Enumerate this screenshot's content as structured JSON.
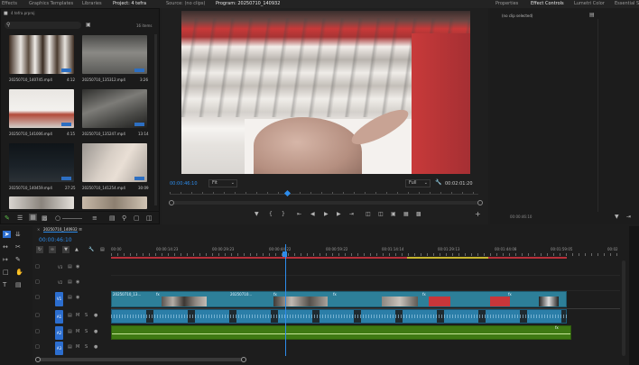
{
  "top_tabs": {
    "effects": "Effects",
    "graphics_templates": "Graphics Templates",
    "libraries": "Libraries",
    "project": "Project: 4 tefra",
    "source": "Source: (no clips)",
    "program": "Program: 20250710_140932",
    "properties": "Properties",
    "effect_controls": "Effect Controls",
    "lumetri": "Lumetri Color",
    "essential": "Essential Sou"
  },
  "project": {
    "file": "4 tefra.prproj",
    "item_count": "16 items",
    "search_placeholder": "",
    "items": [
      {
        "name": "20250710_140745.mp4",
        "duration": "4:12"
      },
      {
        "name": "20250710_135312.mp4",
        "duration": "3:26"
      },
      {
        "name": "20250710_141006.mp4",
        "duration": "4:15"
      },
      {
        "name": "20250710_135247.mp4",
        "duration": "13:14"
      },
      {
        "name": "20250710_140459.mp4",
        "duration": "27:25"
      },
      {
        "name": "20250710_141254.mp4",
        "duration": "30:09"
      }
    ]
  },
  "program": {
    "timecode": "00:00:46:10",
    "fit": "Fit",
    "quality": "Full",
    "duration": "00:02:01:20"
  },
  "effect_controls": {
    "no_clip": "(no clip selected)",
    "timecode": "00:00:46:10"
  },
  "timeline": {
    "sequence_name": "20250710_140932",
    "timecode": "00:00:46:10",
    "ruler": [
      "00:00",
      "00:00:14:23",
      "00:00:29:23",
      "00:00:44:22",
      "00:00:59:22",
      "00:01:14:14",
      "00:01:29:13",
      "00:01:44:08",
      "00:01:59:05",
      "00:02"
    ],
    "tracks": {
      "v3": "V3",
      "v2": "V2",
      "v1": "V1",
      "a1": "A1",
      "a2": "A2",
      "a3": "A3",
      "mute": "M",
      "solo": "S"
    },
    "clip_label_1": "20250710_13...",
    "clip_label_2": "20250710...",
    "clip_fx": "fx"
  },
  "colors": {
    "accent": "#2d8ceb",
    "video_clip": "#2d7f99",
    "audio_clip": "#2b7ea8",
    "music_clip": "#3f7a13",
    "red_bar": "#c8363a"
  }
}
